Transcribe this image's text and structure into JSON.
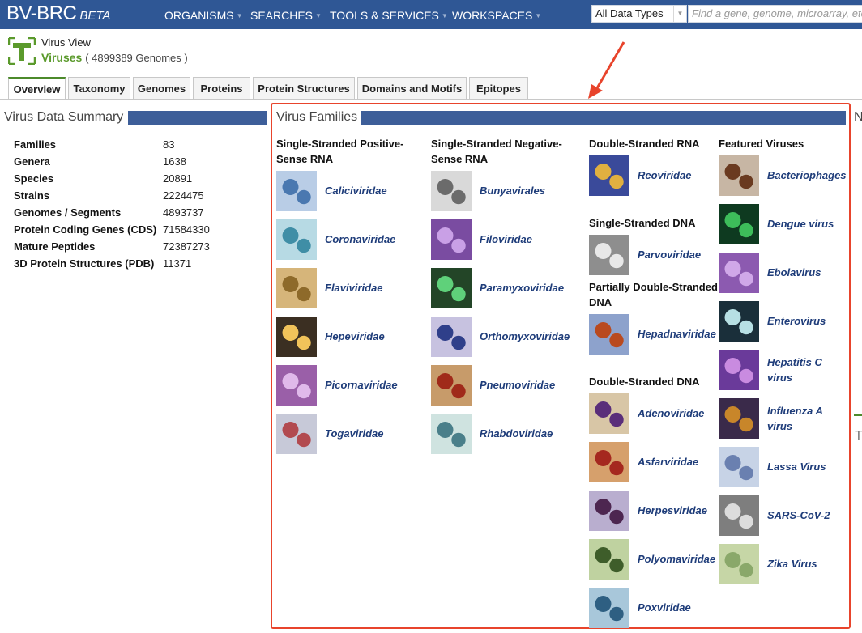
{
  "nav": {
    "brand": "BV-BRC",
    "beta": "BETA",
    "menu": [
      "ORGANISMS",
      "SEARCHES",
      "TOOLS & SERVICES",
      "WORKSPACES"
    ],
    "data_type": "All Data Types",
    "search_placeholder": "Find a gene, genome, microarray, etc."
  },
  "header": {
    "view_title": "Virus View",
    "name": "Viruses",
    "genome_count": "( 4899389 Genomes )"
  },
  "tabs": [
    "Overview",
    "Taxonomy",
    "Genomes",
    "Proteins",
    "Protein Structures",
    "Domains and Motifs",
    "Epitopes"
  ],
  "summary": {
    "title": "Virus Data Summary",
    "rows": [
      {
        "k": "Families",
        "v": "83"
      },
      {
        "k": "Genera",
        "v": "1638"
      },
      {
        "k": "Species",
        "v": "20891"
      },
      {
        "k": "Strains",
        "v": "2224475"
      },
      {
        "k": "Genomes / Segments",
        "v": "4893737"
      },
      {
        "k": "Protein Coding Genes (CDS)",
        "v": "71584330"
      },
      {
        "k": "Mature Peptides",
        "v": "72387273"
      },
      {
        "k": "3D Protein Structures (PDB)",
        "v": "11371"
      }
    ]
  },
  "families": {
    "title": "Virus Families",
    "ssp": {
      "heading": "Single-Stranded Positive-Sense RNA",
      "items": [
        "Caliciviridae",
        "Coronaviridae",
        "Flaviviridae",
        "Hepeviridae",
        "Picornaviridae",
        "Togaviridae"
      ]
    },
    "ssn": {
      "heading": "Single-Stranded Negative-Sense RNA",
      "items": [
        "Bunyavirales",
        "Filoviridae",
        "Paramyxoviridae",
        "Orthomyxoviridae",
        "Pneumoviridae",
        "Rhabdoviridae"
      ]
    },
    "dsrna": {
      "heading": "Double-Stranded RNA",
      "items": [
        "Reoviridae"
      ]
    },
    "ssdna": {
      "heading": "Single-Stranded DNA",
      "items": [
        "Parvoviridae"
      ]
    },
    "pdsdna": {
      "heading": "Partially Double-Stranded DNA",
      "items": [
        "Hepadnaviridae"
      ]
    },
    "dsdna": {
      "heading": "Double-Stranded DNA",
      "items": [
        "Adenoviridae",
        "Asfarviridae",
        "Herpesviridae",
        "Polyomaviridae",
        "Poxviridae"
      ]
    },
    "featured": {
      "heading": "Featured Viruses",
      "items": [
        "Bacteriophages",
        "Dengue virus",
        "Ebolavirus",
        "Enterovirus",
        "Hepatitis C virus",
        "Influenza A virus",
        "Lassa Virus",
        "SARS-CoV-2",
        "Zika Virus"
      ]
    }
  },
  "edge": {
    "n": "N",
    "t": "T"
  },
  "colors": {
    "nav": "#2f5795",
    "bar": "#3d5e99",
    "link": "#1f3d7a",
    "accent": "#5b9a2c",
    "annotation": "#e8442c"
  }
}
